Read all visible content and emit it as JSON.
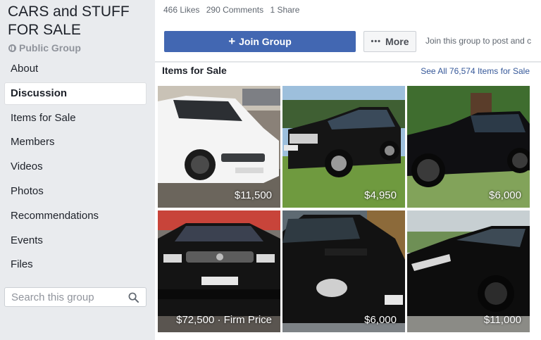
{
  "group": {
    "title": "CARS and STUFF FOR SALE",
    "privacy": "Public Group"
  },
  "nav": {
    "items": [
      {
        "label": "About"
      },
      {
        "label": "Discussion"
      },
      {
        "label": "Items for Sale"
      },
      {
        "label": "Members"
      },
      {
        "label": "Videos"
      },
      {
        "label": "Photos"
      },
      {
        "label": "Recommendations"
      },
      {
        "label": "Events"
      },
      {
        "label": "Files"
      }
    ],
    "active": "Discussion"
  },
  "search": {
    "placeholder": "Search this group",
    "value": "",
    "icon": "search-icon"
  },
  "post_stats": {
    "likes": "466 Likes",
    "comments": "290 Comments",
    "shares": "1 Share"
  },
  "actions": {
    "join_label": "Join Group",
    "more_label": "More",
    "join_hint": "Join this group to post and c"
  },
  "sale": {
    "title": "Items for Sale",
    "see_all": "See All 76,574 Items for Sale",
    "items": [
      {
        "price": "$11,500",
        "color": "#ffffff"
      },
      {
        "price": "$4,950",
        "color": "#151515"
      },
      {
        "price": "$6,000",
        "color": "#0f0f12"
      },
      {
        "price": "$72,500 · Firm Price",
        "color": "#141414"
      },
      {
        "price": "$6,000",
        "color": "#121212"
      },
      {
        "price": "$11,000",
        "color": "#0d0d0d"
      }
    ]
  },
  "colors": {
    "brand": "#4267b2",
    "link": "#365899",
    "background": "#e9ebee"
  }
}
